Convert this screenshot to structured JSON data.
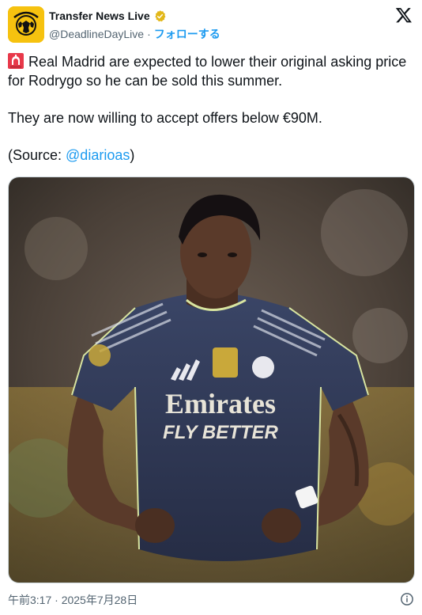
{
  "account": {
    "display_name": "Transfer News Live",
    "handle": "@DeadlineDayLive",
    "separator": "·",
    "follow_label": "フォローする",
    "avatar_color": "#f6c20f",
    "verified_color": "#e2b719",
    "verified_icon": "verified-badge-icon"
  },
  "tweet": {
    "emoji_icon": "rotating-light-icon",
    "line1": "Real Madrid are expected to lower their original asking price for Rodrygo so he can be sold this summer.",
    "line2": "They are now willing to accept offers below €90M.",
    "source_prefix": "(Source: ",
    "source_mention": "@diarioas",
    "source_suffix": ")"
  },
  "media": {
    "kit_text_line1": "Emirates",
    "kit_text_line2": "FLY BETTER"
  },
  "footer": {
    "timestamp": "午前3:17 · 2025年7月28日",
    "info_icon": "info-icon"
  },
  "colors": {
    "link": "#1d9bf0",
    "text": "#0f1419",
    "secondary": "#536471",
    "jersey": "#2f3752"
  }
}
